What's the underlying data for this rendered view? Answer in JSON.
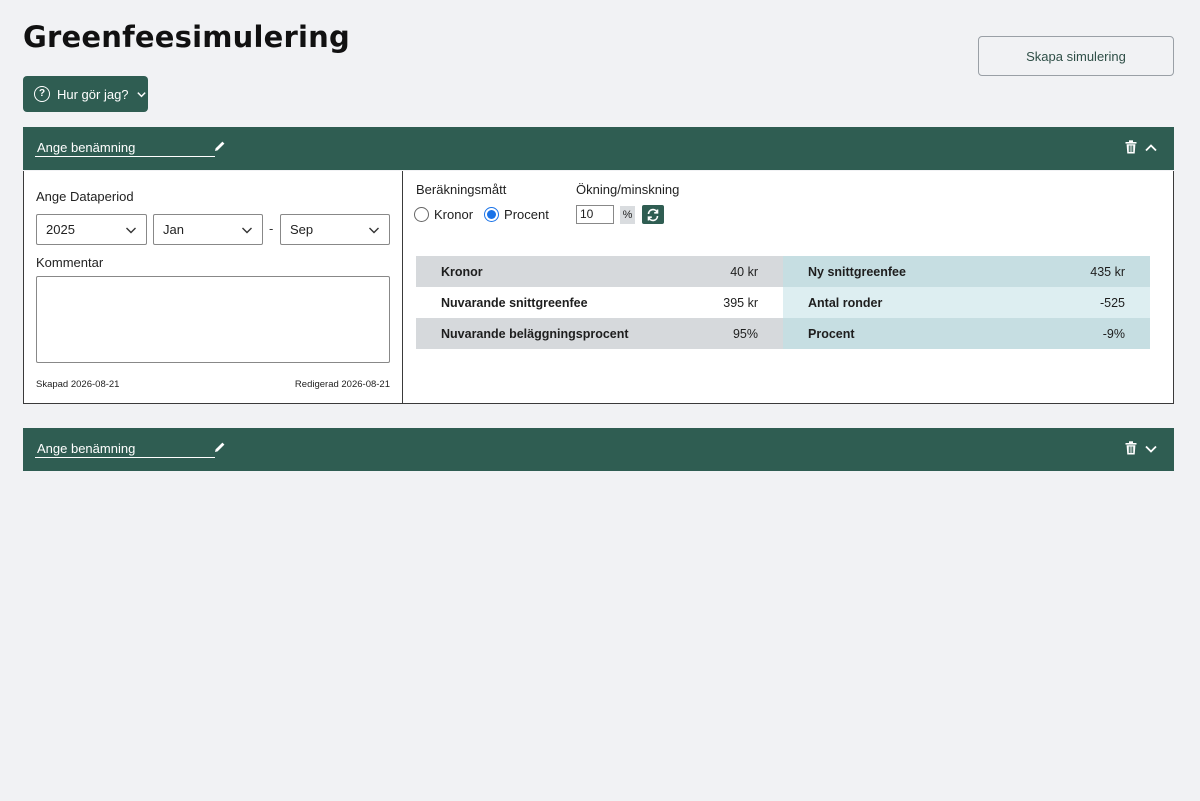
{
  "page": {
    "title": "Greenfeesimulering"
  },
  "toolbar": {
    "create_label": "Skapa simulering",
    "howto_label": "Hur gör jag?"
  },
  "panels": [
    {
      "name_placeholder": "Ange benämning",
      "expanded": true,
      "data_period_label": "Ange Dataperiod",
      "year": "2025",
      "from_month": "Jan",
      "range_separator": "-",
      "to_month": "Sep",
      "comment_label": "Kommentar",
      "comment_value": "",
      "created": "Skapad 2026-08-21",
      "edited": "Redigerad 2026-08-21",
      "calc_measure_label": "Beräkningsmått",
      "options": [
        {
          "label": "Kronor",
          "checked": false
        },
        {
          "label": "Procent",
          "checked": true
        }
      ],
      "change_label": "Ökning/minskning",
      "change_value": "10",
      "change_unit": "%",
      "results_left": [
        {
          "key": "Kronor",
          "value": "40 kr"
        },
        {
          "key": "Nuvarande snittgreenfee",
          "value": "395 kr"
        },
        {
          "key": "Nuvarande beläggningsprocent",
          "value": "95%"
        }
      ],
      "results_right": [
        {
          "key": "Ny snittgreenfee",
          "value": "435 kr"
        },
        {
          "key": "Antal ronder",
          "value": "-525"
        },
        {
          "key": "Procent",
          "value": "-9%"
        }
      ]
    },
    {
      "name_placeholder": "Ange benämning",
      "expanded": false
    }
  ],
  "icons": {
    "help": "question-circle-icon",
    "edit": "pencil-icon",
    "delete": "trash-icon",
    "collapse": "chevron-up-icon",
    "expand": "chevron-down-icon",
    "refresh": "refresh-icon"
  },
  "colors": {
    "brand": "#2f5d52",
    "table_gray": "#d6d9dc",
    "table_teal": "#c6dee2",
    "table_teal_light": "#ddeef1",
    "radio_accent": "#1a73e8"
  }
}
